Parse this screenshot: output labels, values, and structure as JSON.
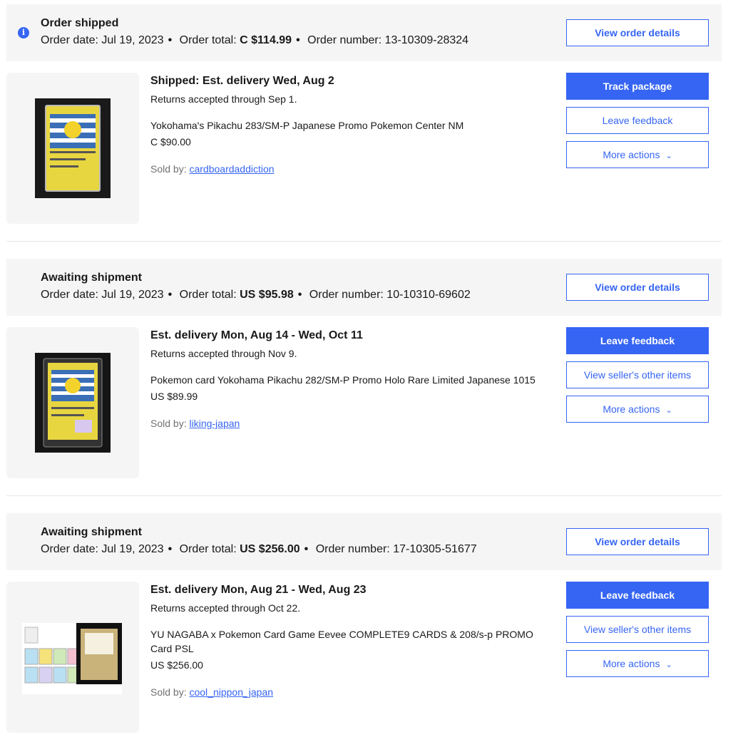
{
  "orders": [
    {
      "status": "Order shipped",
      "order_date_label": "Order date:",
      "order_date": "Jul 19, 2023",
      "order_total_label": "Order total:",
      "order_total": "C $114.99",
      "order_number_label": "Order number:",
      "order_number": "13-10309-28324",
      "view_details": "View order details",
      "info_icon": "i",
      "item_title": "Shipped: Est. delivery Wed, Aug 2",
      "returns": "Returns accepted through Sep 1.",
      "item_name": "Yokohama's Pikachu 283/SM-P Japanese Promo Pokemon Center NM",
      "price": "C $90.00",
      "sold_by_label": "Sold by:",
      "seller": "cardboardaddiction",
      "btn1": "Track package",
      "btn2": "Leave feedback",
      "btn3": "More actions"
    },
    {
      "status": "Awaiting shipment",
      "order_date_label": "Order date:",
      "order_date": "Jul 19, 2023",
      "order_total_label": "Order total:",
      "order_total": "US $95.98",
      "order_number_label": "Order number:",
      "order_number": "10-10310-69602",
      "view_details": "View order details",
      "item_title": "Est. delivery Mon, Aug 14 - Wed, Oct 11",
      "returns": "Returns accepted through Nov 9.",
      "item_name": "Pokemon card Yokohama Pikachu 282/SM-P Promo Holo Rare Limited Japanese 1015",
      "price": "US $89.99",
      "sold_by_label": "Sold by:",
      "seller": "liking-japan",
      "btn1": "Leave feedback",
      "btn2": "View seller's other items",
      "btn3": "More actions"
    },
    {
      "status": "Awaiting shipment",
      "order_date_label": "Order date:",
      "order_date": "Jul 19, 2023",
      "order_total_label": "Order total:",
      "order_total": "US $256.00",
      "order_number_label": "Order number:",
      "order_number": "17-10305-51677",
      "view_details": "View order details",
      "item_title": "Est. delivery Mon, Aug 21 - Wed, Aug 23",
      "returns": "Returns accepted through Oct 22.",
      "item_name": "YU NAGABA x Pokemon Card Game Eevee COMPLETE9 CARDS & 208/s-p PROMO Card PSL",
      "price": "US $256.00",
      "sold_by_label": "Sold by:",
      "seller": "cool_nippon_japan",
      "btn1": "Leave feedback",
      "btn2": "View seller's other items",
      "btn3": "More actions"
    }
  ],
  "icons": {
    "info": "info-icon",
    "chevron": "chevron-down-icon"
  },
  "colors": {
    "accent": "#3665f3",
    "header_bg": "#f5f5f5",
    "muted": "#707070"
  }
}
